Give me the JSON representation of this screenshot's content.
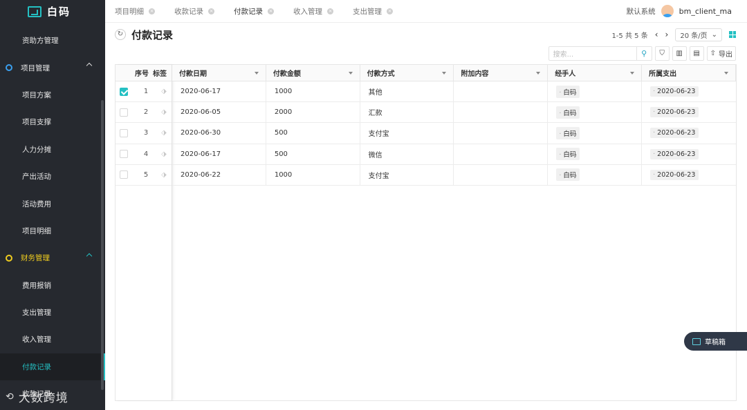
{
  "app": {
    "logo_text": "白码"
  },
  "sidebar": {
    "items": [
      {
        "label": "资助方管理",
        "type": "item"
      },
      {
        "label": "项目管理",
        "type": "group"
      },
      {
        "label": "项目方案",
        "type": "item"
      },
      {
        "label": "项目支撑",
        "type": "item"
      },
      {
        "label": "人力分摊",
        "type": "item"
      },
      {
        "label": "产出活动",
        "type": "item"
      },
      {
        "label": "活动费用",
        "type": "item"
      },
      {
        "label": "项目明细",
        "type": "item"
      },
      {
        "label": "财务管理",
        "type": "group"
      },
      {
        "label": "费用报销",
        "type": "item"
      },
      {
        "label": "支出管理",
        "type": "item"
      },
      {
        "label": "收入管理",
        "type": "item"
      },
      {
        "label": "付款记录",
        "type": "item",
        "active": true
      },
      {
        "label": "收款记录",
        "type": "item"
      }
    ],
    "watermark": "大数跨境"
  },
  "tabs": [
    {
      "label": "项目明细"
    },
    {
      "label": "收款记录"
    },
    {
      "label": "付款记录",
      "active": true
    },
    {
      "label": "收入管理"
    },
    {
      "label": "支出管理"
    }
  ],
  "header": {
    "system": "默认系统",
    "username": "bm_client_ma"
  },
  "page": {
    "title": "付款记录"
  },
  "pager": {
    "range": "1-5",
    "total_text": "共 5 条",
    "per_page": "20 条/页"
  },
  "toolbar": {
    "search_placeholder": "搜索...",
    "export_label": "导出"
  },
  "table": {
    "fixed_headers": {
      "index": "序号",
      "tag": "标签"
    },
    "headers": [
      "付款日期",
      "付款金额",
      "付款方式",
      "附加内容",
      "经手人",
      "所属支出"
    ],
    "rows": [
      {
        "index": "1",
        "checked": true,
        "date": "2020-06-17",
        "amount": "1000",
        "method": "其他",
        "extra": "",
        "handler": "白码",
        "expense": "2020-06-23"
      },
      {
        "index": "2",
        "checked": false,
        "date": "2020-06-05",
        "amount": "2000",
        "method": "汇款",
        "extra": "",
        "handler": "白码",
        "expense": "2020-06-23"
      },
      {
        "index": "3",
        "checked": false,
        "date": "2020-06-30",
        "amount": "500",
        "method": "支付宝",
        "extra": "",
        "handler": "白码",
        "expense": "2020-06-23"
      },
      {
        "index": "4",
        "checked": false,
        "date": "2020-06-17",
        "amount": "500",
        "method": "微信",
        "extra": "",
        "handler": "白码",
        "expense": "2020-06-23"
      },
      {
        "index": "5",
        "checked": false,
        "date": "2020-06-22",
        "amount": "1000",
        "method": "支付宝",
        "extra": "",
        "handler": "白码",
        "expense": "2020-06-23"
      }
    ]
  },
  "draft": {
    "label": "草稿箱"
  }
}
